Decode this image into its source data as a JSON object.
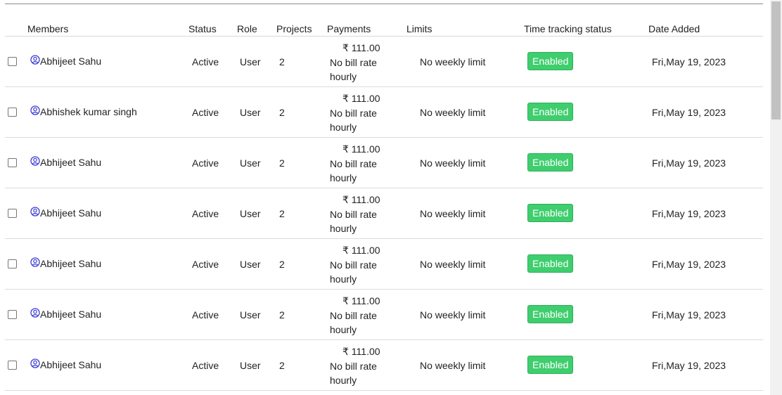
{
  "headers": {
    "members": "Members",
    "status": "Status",
    "role": "Role",
    "projects": "Projects",
    "payments": "Payments",
    "limits": "Limits",
    "time_tracking": "Time tracking status",
    "date_added": "Date Added"
  },
  "rows": [
    {
      "name": "Abhijeet Sahu",
      "status": "Active",
      "role": "User",
      "projects": "2",
      "amount": "₹ 111.00",
      "rate": "No bill rate",
      "rate_unit": "hourly",
      "limit": "No weekly limit",
      "tracking": "Enabled",
      "date": "Fri,May 19, 2023"
    },
    {
      "name": "Abhishek kumar singh",
      "status": "Active",
      "role": "User",
      "projects": "2",
      "amount": "₹ 111.00",
      "rate": "No bill rate",
      "rate_unit": "hourly",
      "limit": "No weekly limit",
      "tracking": "Enabled",
      "date": "Fri,May 19, 2023"
    },
    {
      "name": "Abhijeet Sahu",
      "status": "Active",
      "role": "User",
      "projects": "2",
      "amount": "₹ 111.00",
      "rate": "No bill rate",
      "rate_unit": "hourly",
      "limit": "No weekly limit",
      "tracking": "Enabled",
      "date": "Fri,May 19, 2023"
    },
    {
      "name": "Abhijeet Sahu",
      "status": "Active",
      "role": "User",
      "projects": "2",
      "amount": "₹ 111.00",
      "rate": "No bill rate",
      "rate_unit": "hourly",
      "limit": "No weekly limit",
      "tracking": "Enabled",
      "date": "Fri,May 19, 2023"
    },
    {
      "name": "Abhijeet Sahu",
      "status": "Active",
      "role": "User",
      "projects": "2",
      "amount": "₹ 111.00",
      "rate": "No bill rate",
      "rate_unit": "hourly",
      "limit": "No weekly limit",
      "tracking": "Enabled",
      "date": "Fri,May 19, 2023"
    },
    {
      "name": "Abhijeet Sahu",
      "status": "Active",
      "role": "User",
      "projects": "2",
      "amount": "₹ 111.00",
      "rate": "No bill rate",
      "rate_unit": "hourly",
      "limit": "No weekly limit",
      "tracking": "Enabled",
      "date": "Fri,May 19, 2023"
    },
    {
      "name": "Abhijeet Sahu",
      "status": "Active",
      "role": "User",
      "projects": "2",
      "amount": "₹ 111.00",
      "rate": "No bill rate",
      "rate_unit": "hourly",
      "limit": "No weekly limit",
      "tracking": "Enabled",
      "date": "Fri,May 19, 2023"
    }
  ],
  "colors": {
    "enabled_badge": "#3fce6e",
    "user_icon": "#3b3bd6"
  },
  "icons": {
    "member": "user-circle-icon"
  }
}
